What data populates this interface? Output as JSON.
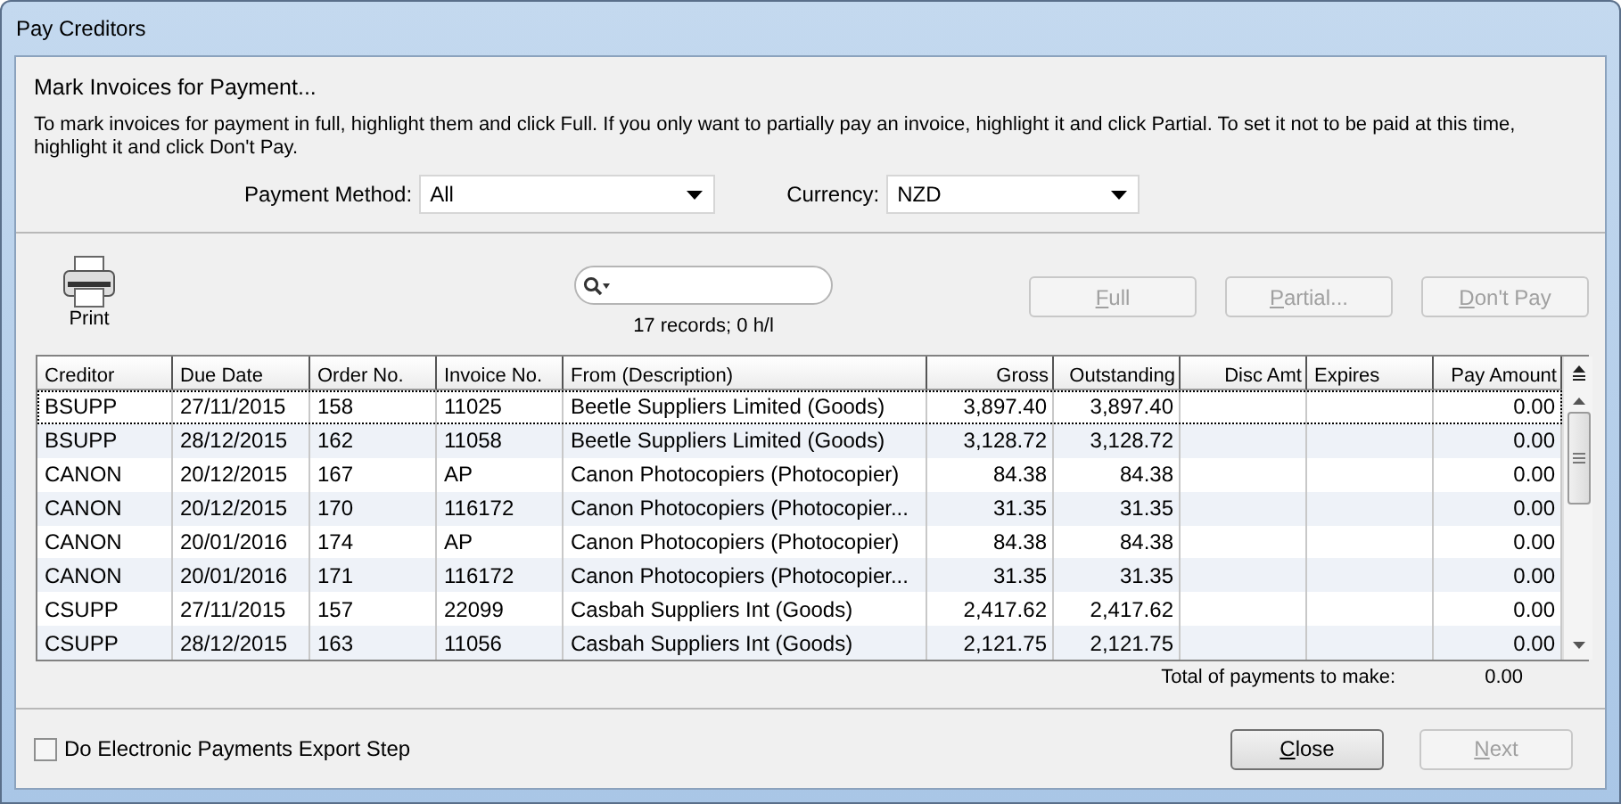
{
  "window": {
    "title": "Pay Creditors"
  },
  "heading": "Mark Invoices for Payment...",
  "instructions": "To mark invoices for payment in full, highlight them and click Full. If you only want to partially pay an invoice, highlight it and click Partial. To set it not to be paid at this time, highlight it and click Don't Pay.",
  "filters": [
    {
      "label": "Payment Method:",
      "value": "All"
    },
    {
      "label": "Currency:",
      "value": "NZD"
    }
  ],
  "print_button": "Print",
  "search": {
    "status": "17 records; 0 h/l"
  },
  "action_buttons": [
    {
      "label": "Full",
      "disabled": true
    },
    {
      "label": "Partial...",
      "disabled": true
    },
    {
      "label": "Don't Pay",
      "disabled": true
    }
  ],
  "table": {
    "columns": [
      {
        "label": "Creditor",
        "kind": "text"
      },
      {
        "label": "Due Date",
        "kind": "text"
      },
      {
        "label": "Order No.",
        "kind": "text"
      },
      {
        "label": "Invoice No.",
        "kind": "text"
      },
      {
        "label": "From (Description)",
        "kind": "text"
      },
      {
        "label": "Gross",
        "kind": "amount"
      },
      {
        "label": "Outstanding",
        "kind": "amount"
      },
      {
        "label": "Disc Amt",
        "kind": "amount"
      },
      {
        "label": "Expires",
        "kind": "text"
      },
      {
        "label": "Pay Amount",
        "kind": "amount"
      }
    ],
    "rows": [
      {
        "focused": true,
        "cells": [
          "BSUPP",
          "27/11/2015",
          "158",
          "11025",
          "Beetle Suppliers Limited (Goods)",
          "3,897.40",
          "3,897.40",
          "",
          "",
          "0.00"
        ]
      },
      {
        "focused": false,
        "cells": [
          "BSUPP",
          "28/12/2015",
          "162",
          "11058",
          "Beetle Suppliers Limited (Goods)",
          "3,128.72",
          "3,128.72",
          "",
          "",
          "0.00"
        ]
      },
      {
        "focused": false,
        "cells": [
          "CANON",
          "20/12/2015",
          "167",
          "AP",
          "Canon Photocopiers (Photocopier)",
          "84.38",
          "84.38",
          "",
          "",
          "0.00"
        ]
      },
      {
        "focused": false,
        "cells": [
          "CANON",
          "20/12/2015",
          "170",
          "116172",
          "Canon Photocopiers (Photocopier...",
          "31.35",
          "31.35",
          "",
          "",
          "0.00"
        ]
      },
      {
        "focused": false,
        "cells": [
          "CANON",
          "20/01/2016",
          "174",
          "AP",
          "Canon Photocopiers (Photocopier)",
          "84.38",
          "84.38",
          "",
          "",
          "0.00"
        ]
      },
      {
        "focused": false,
        "cells": [
          "CANON",
          "20/01/2016",
          "171",
          "116172",
          "Canon Photocopiers (Photocopier...",
          "31.35",
          "31.35",
          "",
          "",
          "0.00"
        ]
      },
      {
        "focused": false,
        "cells": [
          "CSUPP",
          "27/11/2015",
          "157",
          "22099",
          "Casbah Suppliers Int (Goods)",
          "2,417.62",
          "2,417.62",
          "",
          "",
          "0.00"
        ]
      },
      {
        "focused": false,
        "cells": [
          "CSUPP",
          "28/12/2015",
          "163",
          "11056",
          "Casbah Suppliers Int (Goods)",
          "2,121.75",
          "2,121.75",
          "",
          "",
          "0.00"
        ]
      }
    ]
  },
  "total": {
    "label": "Total of payments to make:",
    "value": "0.00"
  },
  "export_checkbox": {
    "label": "Do Electronic Payments Export Step",
    "checked": false
  },
  "footer_buttons": [
    {
      "label": "Close",
      "disabled": false
    },
    {
      "label": "Next",
      "disabled": true
    }
  ]
}
